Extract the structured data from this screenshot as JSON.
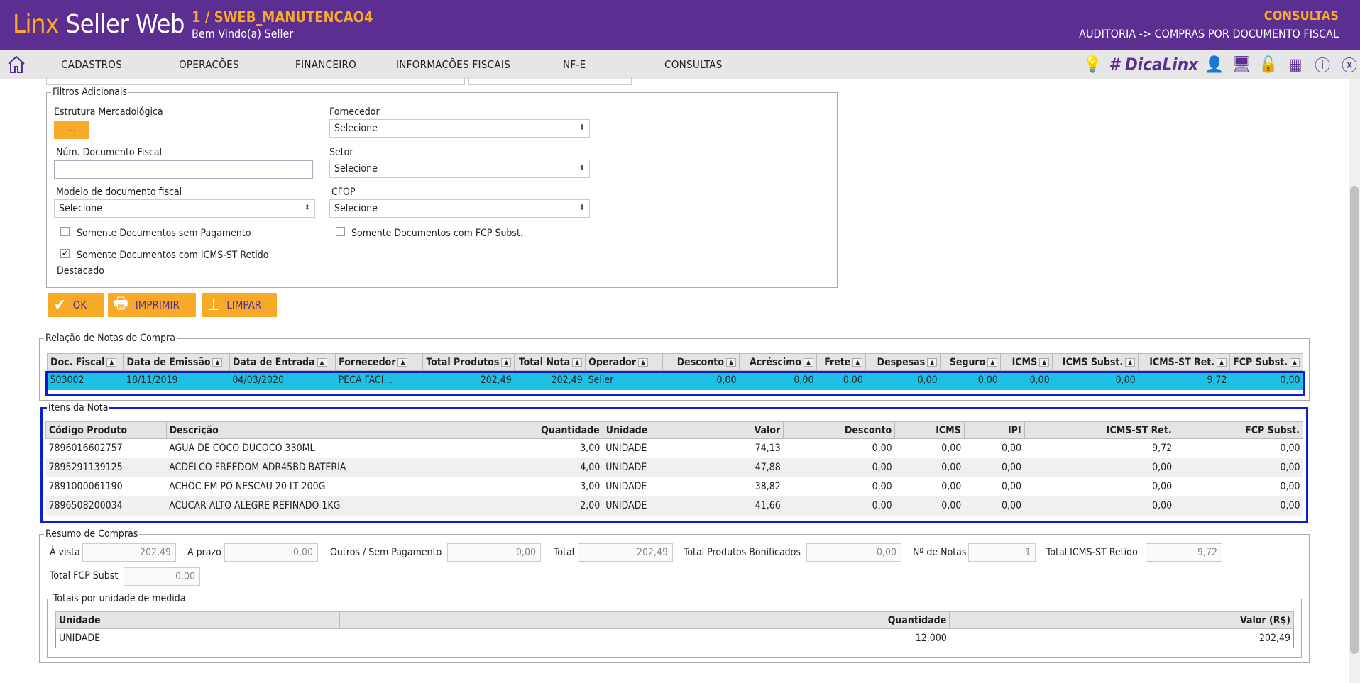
{
  "header": {
    "logo_part1": "Linx",
    "logo_part2": " Seller Web",
    "environment": "1 / SWEB_MANUTENCAO4",
    "welcome": "Bem Vindo(a) Seller",
    "module": "CONSULTAS",
    "breadcrumb": "AUDITORIA -> COMPRAS POR DOCUMENTO FISCAL"
  },
  "nav": {
    "items": [
      "CADASTROS",
      "OPERAÇÕES",
      "FINANCEIRO",
      "INFORMAÇÕES FISCAIS",
      "NF-E",
      "CONSULTAS"
    ],
    "brand": "# DicaLinx"
  },
  "filters": {
    "legend": "Filtros Adicionais",
    "estrutura_label": "Estrutura Mercadológica",
    "estrutura_btn": "...",
    "fornecedor_label": "Fornecedor",
    "fornecedor_value": "Selecione",
    "num_doc_label": "Núm. Documento Fiscal",
    "num_doc_value": "",
    "setor_label": "Setor",
    "setor_value": "Selecione",
    "modelo_label": "Modelo de documento fiscal",
    "modelo_value": "Selecione",
    "cfop_label": "CFOP",
    "cfop_value": "Selecione",
    "chk_sem_pagamento": "Somente Documentos sem Pagamento",
    "chk_fcp": "Somente Documentos com FCP Subst.",
    "chk_icms_line1": "Somente Documentos com ICMS-ST Retido",
    "chk_icms_line2": "Destacado",
    "chk_icms_mark": "✔"
  },
  "buttons": {
    "ok": "OK",
    "imprimir": "IMPRIMIR",
    "limpar": "LIMPAR"
  },
  "notas": {
    "legend": "Relação de Notas de Compra",
    "columns": [
      "Doc. Fiscal",
      "Data de Emissão",
      "Data de Entrada",
      "Fornecedor",
      "Total Produtos",
      "Total Nota",
      "Operador",
      "Desconto",
      "Acréscimo",
      "Frete",
      "Despesas",
      "Seguro",
      "ICMS",
      "ICMS Subst.",
      "ICMS-ST Ret.",
      "FCP Subst."
    ],
    "rows": [
      [
        "503002",
        "18/11/2019",
        "04/03/2020",
        "PECA FACI...",
        "202,49",
        "202,49",
        "Seller",
        "0,00",
        "0,00",
        "0,00",
        "0,00",
        "0,00",
        "0,00",
        "0,00",
        "9,72",
        "0,00"
      ]
    ]
  },
  "itens": {
    "legend": "Itens da Nota",
    "columns": [
      "Código Produto",
      "Descrição",
      "Quantidade",
      "Unidade",
      "Valor",
      "Desconto",
      "ICMS",
      "IPI",
      "ICMS-ST Ret.",
      "FCP Subst."
    ],
    "rows": [
      [
        "7896016602757",
        "AGUA DE COCO DUCOCO 330ML",
        "3,00",
        "UNIDADE",
        "74,13",
        "0,00",
        "0,00",
        "0,00",
        "9,72",
        "0,00"
      ],
      [
        "7895291139125",
        "ACDELCO FREEDOM ADR45BD BATERIA",
        "4,00",
        "UNIDADE",
        "47,88",
        "0,00",
        "0,00",
        "0,00",
        "0,00",
        "0,00"
      ],
      [
        "7891000061190",
        "ACHOC EM PO NESCAU 20 LT 200G",
        "3,00",
        "UNIDADE",
        "38,82",
        "0,00",
        "0,00",
        "0,00",
        "0,00",
        "0,00"
      ],
      [
        "7896508200034",
        "ACUCAR ALTO ALEGRE REFINADO 1KG",
        "2,00",
        "UNIDADE",
        "41,66",
        "0,00",
        "0,00",
        "0,00",
        "0,00",
        "0,00"
      ]
    ]
  },
  "resumo": {
    "legend": "Resumo de Compras",
    "a_vista_label": "À vista",
    "a_vista": "202,49",
    "a_prazo_label": "A prazo",
    "a_prazo": "0,00",
    "outros_label": "Outros / Sem Pagamento",
    "outros": "0,00",
    "total_label": "Total",
    "total": "202,49",
    "bonif_label": "Total Produtos Bonificados",
    "bonif": "0,00",
    "notas_label": "Nº de Notas",
    "notas": "1",
    "icms_label": "Total ICMS-ST Retido",
    "icms": "9,72",
    "fcp_label": "Total FCP Subst",
    "fcp": "0,00"
  },
  "totais": {
    "legend": "Totais por unidade de medida",
    "columns": [
      "Unidade",
      "Quantidade",
      "Valor (R$)"
    ],
    "rows": [
      [
        "UNIDADE",
        "12,000",
        "202,49"
      ]
    ]
  }
}
